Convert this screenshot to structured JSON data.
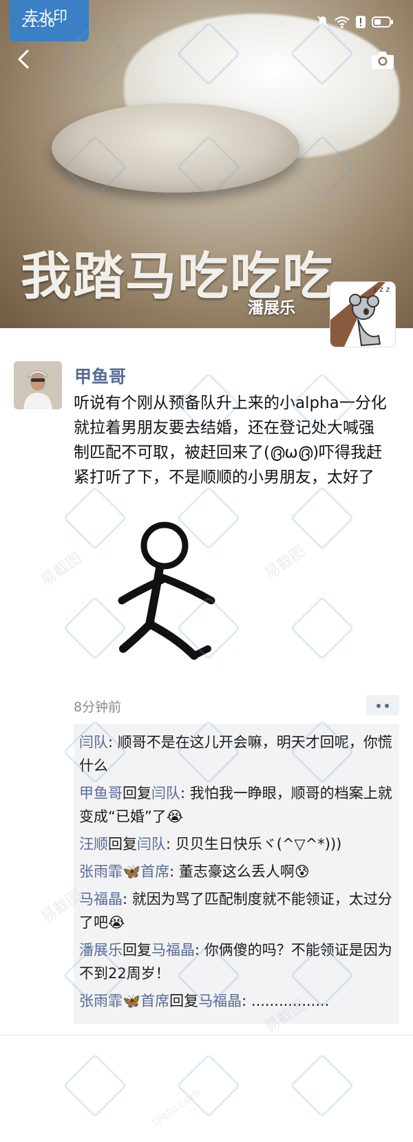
{
  "status_bar": {
    "watermark_label": "去水印",
    "time": "21:56"
  },
  "cover": {
    "caption": "我踏马吃吃吃",
    "profile_name": "潘展乐"
  },
  "post": {
    "author": "甲鱼哥",
    "text": "听说有个刚从预备队升上来的小alpha一分化就拉着男朋友要去结婚，还在登记处大喊强制匹配不可取，被赶回来了(൫ω൫)吓得我赶紧打听了下，不是顺顺的小男朋友，太好了",
    "time_ago": "8分钟前"
  },
  "comments": [
    {
      "name": "闫队",
      "reply_word": "",
      "target": "",
      "text": ": 顺哥不是在这儿开会嘛，明天才回呢，你慌什么"
    },
    {
      "name": "甲鱼哥",
      "reply_word": "回复",
      "target": "闫队",
      "text": ": 我怕我一睁眼，顺哥的档案上就变成“已婚”了😭"
    },
    {
      "name": "汪顺",
      "reply_word": "回复",
      "target": "闫队",
      "text": ": 贝贝生日快乐ヾ(^▽^*)))"
    },
    {
      "name": "张雨霏🦋首席",
      "reply_word": "",
      "target": "",
      "text": ": 董志豪这么丢人啊😰"
    },
    {
      "name": "马福晶",
      "reply_word": "",
      "target": "",
      "text": ": 就因为骂了匹配制度就不能领证，太过分了吧😭"
    },
    {
      "name": "潘展乐",
      "reply_word": "回复",
      "target": "马福晶",
      "text": ": 你俩傻的吗？不能领证是因为不到22周岁！"
    },
    {
      "name": "张雨霏🦋首席",
      "reply_word": "回复",
      "target": "马福晶",
      "text": ": ................."
    }
  ],
  "watermark": {
    "site": "易截图",
    "domain": "tjietu.com"
  },
  "icons": {
    "back": "chevron-left-icon",
    "camera": "camera-icon",
    "more": "more-dots-icon"
  },
  "colors": {
    "link_name": "#576b95",
    "watermark_tag": "#3b7fc4",
    "comment_bg": "#f3f3f5"
  }
}
